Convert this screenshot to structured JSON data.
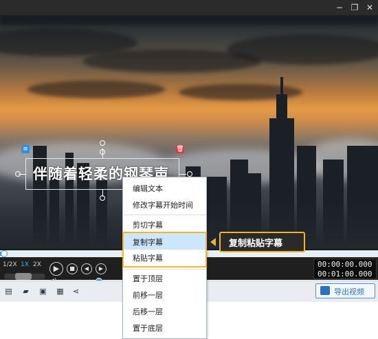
{
  "window": {
    "minimize_glyph": "−",
    "restore_glyph": "❐",
    "close_glyph": "✕"
  },
  "subtitle": {
    "text": "伴随着轻柔的钢琴声",
    "edit_icon": "text-lines-icon",
    "delete_icon": "trash-icon"
  },
  "player": {
    "speed_options": [
      "1/2X",
      "1X",
      "2X"
    ],
    "selected_speed": "1X",
    "progress": 0.01,
    "volume_level": 0.7,
    "current_time": "00:00:00.000",
    "total_time": "00:01:00.000"
  },
  "toolbar": {
    "icons": [
      "subtitle-list-icon",
      "open-folder-icon",
      "save-icon",
      "save-as-icon",
      "share-icon"
    ],
    "export_label": "导出视频"
  },
  "context_menu": {
    "items": [
      {
        "label": "编辑文本"
      },
      {
        "label": "修改字幕开始时间"
      },
      {
        "label": "剪切字幕"
      },
      {
        "label": "复制字幕"
      },
      {
        "label": "粘贴字幕"
      },
      {
        "label": "置于顶层"
      },
      {
        "label": "前移一层"
      },
      {
        "label": "后移一层"
      },
      {
        "label": "置于底层"
      }
    ],
    "highlighted": "复制字幕"
  },
  "callout": {
    "label": "复制粘贴字幕"
  },
  "colors": {
    "accent_yellow": "#f5b51b",
    "accent_blue": "#3a9bd9",
    "menu_highlight": "#cce6fb",
    "dark_ui": "#1f1f1f"
  }
}
